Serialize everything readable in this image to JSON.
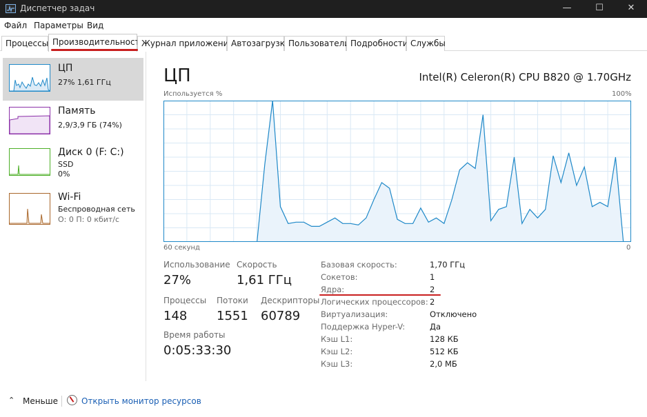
{
  "window": {
    "title": "Диспетчер задач",
    "minimize": "—",
    "maximize": "☐",
    "close": "✕"
  },
  "menu": [
    "Файл",
    "Параметры",
    "Вид"
  ],
  "tabs": [
    {
      "label": "Процессы"
    },
    {
      "label": "Производительность",
      "active": true
    },
    {
      "label": "Журнал приложений"
    },
    {
      "label": "Автозагрузка"
    },
    {
      "label": "Пользователи"
    },
    {
      "label": "Подробности"
    },
    {
      "label": "Службы"
    }
  ],
  "sidebar": {
    "items": [
      {
        "name": "ЦП",
        "line1": "27%  1,61 ГГц",
        "line2": "",
        "color": "#1e88c8",
        "active": true
      },
      {
        "name": "Память",
        "line1": "2,9/3,9 ГБ (74%)",
        "line2": "",
        "color": "#8b2fa8"
      },
      {
        "name": "Диск 0 (F: C:)",
        "line1": "SSD",
        "line2": "0%",
        "color": "#4caf26"
      },
      {
        "name": "Wi-Fi",
        "line1": "Беспроводная сеть",
        "line2": "О: 0 П: 0 кбит/с",
        "color": "#a9662a"
      }
    ]
  },
  "main": {
    "title": "ЦП",
    "cpu_name": "Intel(R) Celeron(R) CPU B820 @ 1.70GHz",
    "stats": {
      "usage_label": "Использование",
      "usage_value": "27%",
      "speed_label": "Скорость",
      "speed_value": "1,61 ГГц",
      "processes_label": "Процессы",
      "processes_value": "148",
      "threads_label": "Потоки",
      "threads_value": "1551",
      "handles_label": "Дескрипторы",
      "handles_value": "60789",
      "uptime_label": "Время работы",
      "uptime_value": "0:05:33:30"
    },
    "info": [
      {
        "label": "Базовая скорость:",
        "value": "1,70 ГГц"
      },
      {
        "label": "Сокетов:",
        "value": "1"
      },
      {
        "label": "Ядра:",
        "value": "2"
      },
      {
        "label": "Логических процессоров:",
        "value": "2"
      },
      {
        "label": "Виртуализация:",
        "value": "Отключено"
      },
      {
        "label": "Поддержка Hyper-V:",
        "value": "Да"
      },
      {
        "label": "Кэш L1:",
        "value": "128 КБ"
      },
      {
        "label": "Кэш L2:",
        "value": "512 КБ"
      },
      {
        "label": "Кэш L3:",
        "value": "2,0 МБ"
      }
    ]
  },
  "footer": {
    "less_label": "Меньше",
    "monitor_label": "Открыть монитор ресурсов"
  },
  "chart_data": {
    "type": "area",
    "title": "",
    "ylabel": "Используется %",
    "ymax_label": "100%",
    "xlabel_left": "60 секунд",
    "xlabel_right": "0",
    "ylim": [
      0,
      100
    ],
    "xlim": [
      60,
      0
    ],
    "grid": true,
    "color": "#1e88c8",
    "fill": "#eaf3fb",
    "x": [
      60,
      59,
      58,
      57,
      56,
      55,
      54,
      53,
      52,
      51,
      50,
      49,
      48,
      47,
      46,
      45,
      44,
      43,
      42,
      41,
      40,
      39,
      38,
      37,
      36,
      35,
      34,
      33,
      32,
      31,
      30,
      29,
      28,
      27,
      26,
      25,
      24,
      23,
      22,
      21,
      20,
      19,
      18,
      17,
      16,
      15,
      14,
      13,
      12,
      11,
      10,
      9,
      8,
      7,
      6,
      5,
      4,
      3,
      2,
      1,
      0
    ],
    "series": [
      {
        "values": [
          0,
          0,
          0,
          0,
          0,
          0,
          0,
          0,
          0,
          0,
          0,
          0,
          0,
          55,
          100,
          25,
          13,
          14,
          14,
          11,
          11,
          14,
          17,
          13,
          13,
          12,
          17,
          30,
          42,
          38,
          16,
          13,
          13,
          24,
          14,
          17,
          13,
          30,
          51,
          56,
          52,
          90,
          15,
          23,
          25,
          60,
          13,
          23,
          17,
          23,
          61,
          42,
          63,
          40,
          53,
          25,
          28,
          25,
          60,
          0
        ]
      }
    ]
  }
}
